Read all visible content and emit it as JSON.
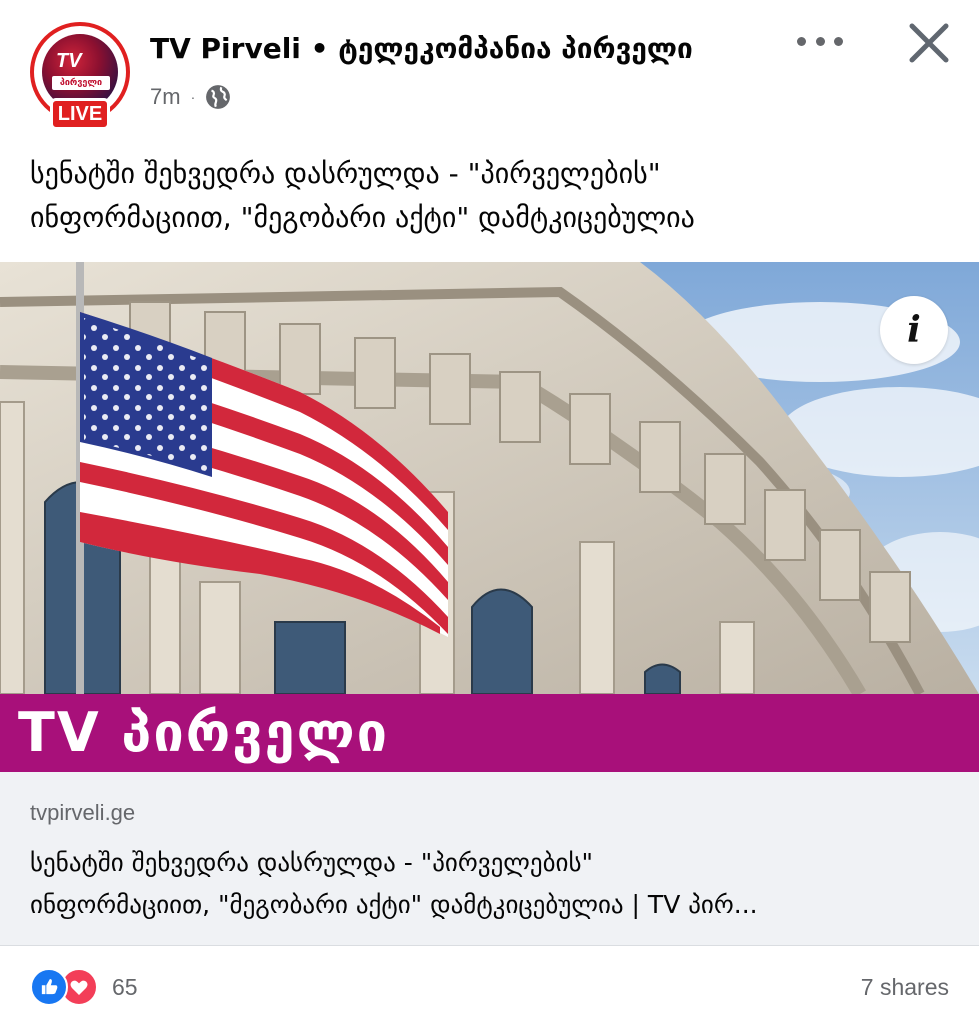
{
  "header": {
    "avatar_logo": "TV",
    "avatar_sub": "პირველი",
    "live_badge": "LIVE",
    "page_name": "TV Pirveli • ტელეკომპანია პირველი",
    "time": "7m",
    "dot": "·",
    "privacy_icon": "globe-icon",
    "more_icon": "more-horizontal-icon",
    "close_icon": "close-icon"
  },
  "post": {
    "text_line1": "სენატში შეხვედრა დასრულდა - \"პირველების\"",
    "text_line2": "ინფორმაციით, \"მეგობარი აქტი\" დამტკიცებულია"
  },
  "image": {
    "info_label": "i",
    "brand_text": "TV პირველი",
    "colors": {
      "brand_bar": "#a8107a",
      "flag_red": "#d2283c",
      "flag_blue": "#2a3b8f",
      "sky": "#8fb5dc"
    }
  },
  "link_preview": {
    "domain": "tvpirveli.ge",
    "title_line1": "სენატში შეხვედრა დასრულდა - \"პირველების\"",
    "title_line2": "ინფორმაციით, \"მეგობარი აქტი\" დამტკიცებულია | TV პირ..."
  },
  "footer": {
    "reaction_icons": [
      "like-icon",
      "love-icon"
    ],
    "reaction_count": "65",
    "shares": "7 shares"
  }
}
